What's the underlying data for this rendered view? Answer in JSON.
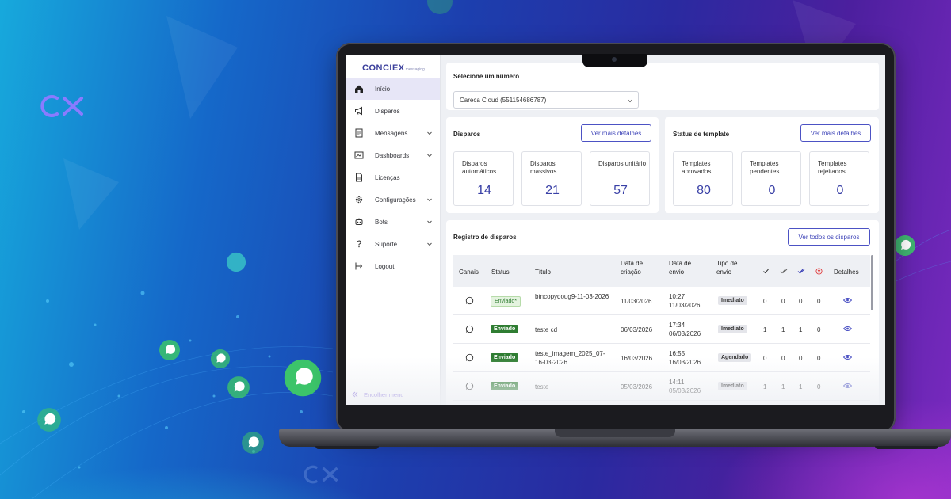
{
  "brand": {
    "mark": "CX",
    "bottom_mark": "CX"
  },
  "colors": {
    "accent": "#3e44b8",
    "success": "#2f7d32",
    "sidebar_active": "#e7e6f7",
    "bg_left": "#17a9dc",
    "bg_right": "#7a2ac0"
  },
  "app": {
    "logo": "CONCIEX",
    "logo_sub": "messaging",
    "sidebar": {
      "items": [
        {
          "label": "Início",
          "icon": "home-icon",
          "active": true,
          "expandable": false
        },
        {
          "label": "Disparos",
          "icon": "megaphone-icon",
          "active": false,
          "expandable": false
        },
        {
          "label": "Mensagens",
          "icon": "message-icon",
          "active": false,
          "expandable": true
        },
        {
          "label": "Dashboards",
          "icon": "chart-icon",
          "active": false,
          "expandable": true
        },
        {
          "label": "Licenças",
          "icon": "document-icon",
          "active": false,
          "expandable": false
        },
        {
          "label": "Configurações",
          "icon": "gear-icon",
          "active": false,
          "expandable": true
        },
        {
          "label": "Bots",
          "icon": "bot-icon",
          "active": false,
          "expandable": true
        },
        {
          "label": "Suporte",
          "icon": "help-icon",
          "active": false,
          "expandable": true
        },
        {
          "label": "Logout",
          "icon": "logout-icon",
          "active": false,
          "expandable": false
        }
      ],
      "collapse_label": "Encolher menu"
    },
    "number_select": {
      "label": "Selecione um número",
      "value": "Careca Cloud (551154686787)"
    },
    "disparos": {
      "title": "Disparos",
      "button": "Ver mais detalhes",
      "stats": [
        {
          "label": "Disparos automáticos",
          "value": "14"
        },
        {
          "label": "Disparos massivos",
          "value": "21"
        },
        {
          "label": "Disparos unitário",
          "value": "57"
        }
      ]
    },
    "templates": {
      "title": "Status de template",
      "button": "Ver mais detalhes",
      "stats": [
        {
          "label": "Templates aprovados",
          "value": "80"
        },
        {
          "label": "Templates pendentes",
          "value": "0"
        },
        {
          "label": "Templates rejeitados",
          "value": "0"
        }
      ]
    },
    "registro": {
      "title": "Registro de disparos",
      "button": "Ver todos os disparos",
      "columns": [
        "Canais",
        "Status",
        "Título",
        "Data de criação",
        "Data de envio",
        "Tipo de envio",
        "Detalhes"
      ],
      "rows": [
        {
          "status": "Enviado*",
          "status_style": "pending",
          "title": "btncopydoug9-11-03-2026",
          "created": "11/03/2026",
          "sent_time": "10:27",
          "sent_date": "11/03/2026",
          "type": "Imediato",
          "c1": "0",
          "c2": "0",
          "c3": "0",
          "c4": "0"
        },
        {
          "status": "Enviado",
          "status_style": "sent",
          "title": "teste cd",
          "created": "06/03/2026",
          "sent_time": "17:34",
          "sent_date": "06/03/2026",
          "type": "Imediato",
          "c1": "1",
          "c2": "1",
          "c3": "1",
          "c4": "0"
        },
        {
          "status": "Enviado",
          "status_style": "sent",
          "title": "teste_imagem_2025_07-16-03-2026",
          "created": "16/03/2026",
          "sent_time": "16:55",
          "sent_date": "16/03/2026",
          "type": "Agendado",
          "c1": "0",
          "c2": "0",
          "c3": "0",
          "c4": "0"
        },
        {
          "status": "Enviado",
          "status_style": "sent",
          "title": "teste",
          "created": "05/03/2026",
          "sent_time": "14:11",
          "sent_date": "05/03/2026",
          "type": "Imediato",
          "c1": "1",
          "c2": "1",
          "c3": "1",
          "c4": "0"
        }
      ]
    }
  }
}
